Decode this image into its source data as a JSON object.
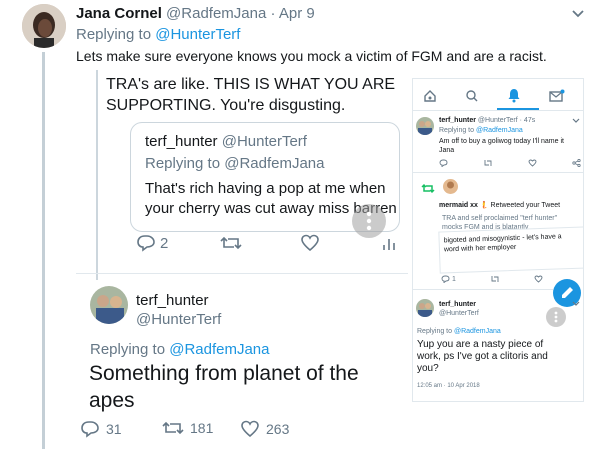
{
  "tweet": {
    "author_name": "Jana Cornel",
    "author_handle": "@RadfemJana",
    "separator": "·",
    "date": "Apr 9",
    "replying_prefix": "Replying to",
    "replying_to": "@HunterTerf",
    "text": "Lets make sure everyone knows you mock a victim of FGM and are a racist."
  },
  "left_shot": {
    "top_text_line1": "TRA's are like. THIS IS WHAT YOU ARE",
    "top_text_line2": "SUPPORTING. You're disgusting.",
    "quoted": {
      "name": "terf_hunter",
      "handle": "@HunterTerf",
      "replying_prefix": "Replying to",
      "replying_to": "@RadfemJana",
      "text_line1": "That's rich having a pop at me when",
      "text_line2": "your cherry was cut away miss barren"
    },
    "quoted_actions": {
      "reply_count": "2"
    },
    "bottom_tweet": {
      "name": "terf_hunter",
      "handle": "@HunterTerf",
      "replying_prefix": "Replying to",
      "replying_to": "@RadfemJana",
      "text_line1": "Something from planet of the",
      "text_line2": "apes"
    }
  },
  "right_shot": {
    "tweet1": {
      "name": "terf_hunter",
      "handle": "@HunterTerf",
      "time": "· 47s",
      "replying_prefix": "Replying to",
      "replying_to": "@RadfemJana",
      "text_line1": "Am off to buy a goliwog today I'll name it",
      "text_line2": "Jana"
    },
    "retweet_notice": {
      "name": "mermaid xx",
      "emoji": "🧜",
      "action": "Retweeted your Tweet",
      "text_line1": "TRA and self proclaimed \"terf hunter\"",
      "text_line2": "mocks FGM and is blatantly",
      "overlap_line1": "bigoted and misogynistic - let's have a",
      "overlap_line2": "word with her employer",
      "reply_count": "1"
    },
    "tweet2": {
      "name": "terf_hunter",
      "handle": "@HunterTerf",
      "replying_prefix": "Replying to",
      "replying_to": "@RadfemJana",
      "text_line1": "Yup you are a nasty piece of",
      "text_line2": "work, ps I've got a clitoris and",
      "text_line3": "you?",
      "timestamp": "12:05 am · 10 Apr 2018"
    }
  },
  "actions": {
    "reply_count": "31",
    "retweet_count": "181",
    "like_count": "263"
  },
  "colors": {
    "twitter_blue": "#1b95e0",
    "retweet_green": "#17bf63",
    "muted": "#657786"
  }
}
